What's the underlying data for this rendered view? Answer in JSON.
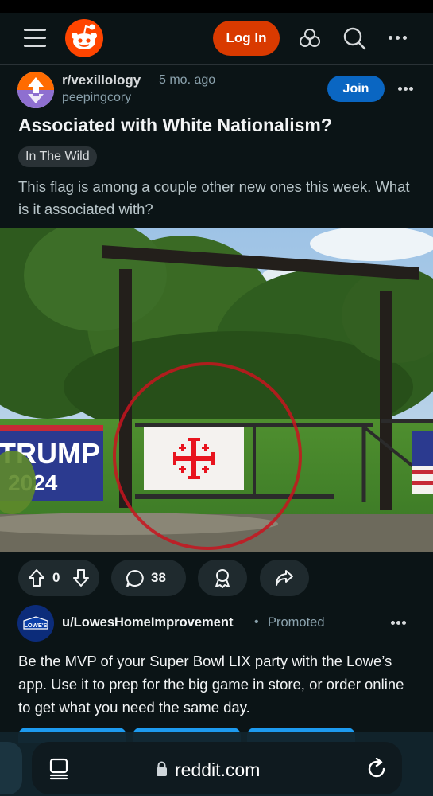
{
  "nav": {
    "login_label": "Log In"
  },
  "post": {
    "subreddit": "r/vexillology",
    "age": "5 mo. ago",
    "author": "peepingcory",
    "join_label": "Join",
    "title": "Associated with White Nationalism?",
    "flair": "In The Wild",
    "body": "This flag is among a couple other new ones this week. What is it associated with?",
    "image_text": {
      "sign_line1": "TRUMP",
      "sign_line2": "2024"
    },
    "votes": "0",
    "comments": "38"
  },
  "promo": {
    "avatar_text": "LOWE'S",
    "user": "u/LowesHomeImprovement",
    "separator": "•",
    "label": "Promoted",
    "text": "Be the MVP of your Super Bowl LIX party with the Lowe’s app. Use it to prep for the big game in store, or order online to get what you need the same day."
  },
  "browser": {
    "url": "reddit.com"
  },
  "colors": {
    "background": "#0b1416",
    "login": "#d93a00",
    "join": "#0a66c2",
    "pill": "#1f2a2e",
    "reddit_orange": "#ff4500",
    "circle_annotation": "#c8141e",
    "flag_cross": "#e8141e"
  },
  "icons": {
    "menu": "hamburger-icon",
    "logo": "reddit-logo",
    "advertise": "advertise-icon",
    "search": "search-icon",
    "more": "more-icon",
    "upvote": "upvote-arrow-icon",
    "downvote": "downvote-arrow-icon",
    "comment": "comment-bubble-icon",
    "award": "award-icon",
    "share": "share-arrow-icon",
    "tabs": "tabs-icon",
    "lock": "lock-icon",
    "reload": "reload-icon"
  }
}
